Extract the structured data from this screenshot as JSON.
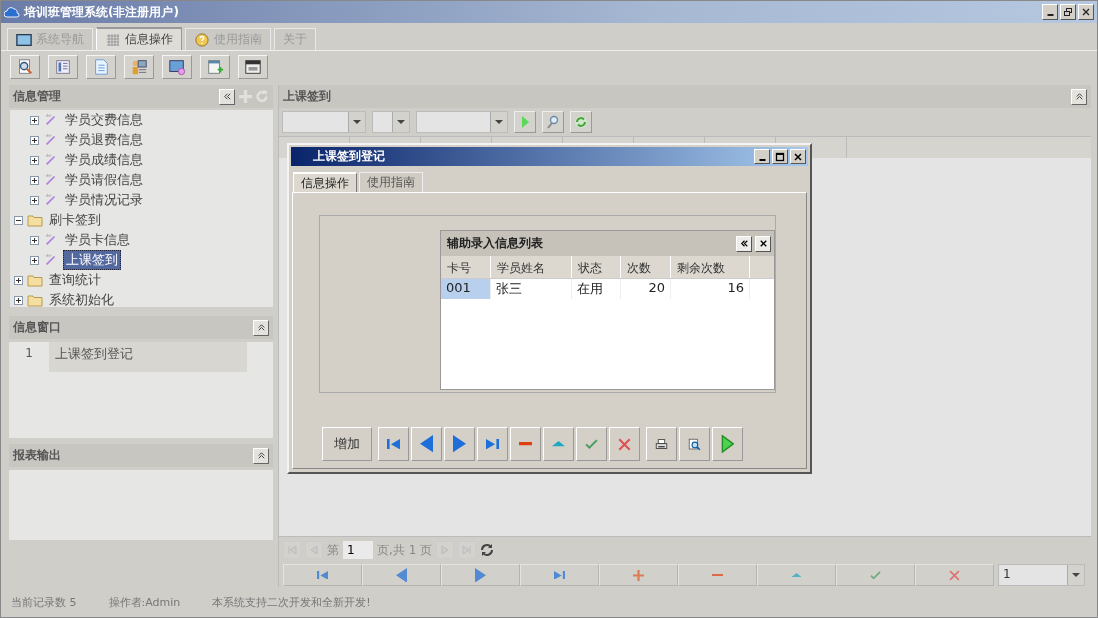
{
  "window": {
    "title": "培训班管理系统(非注册用户)"
  },
  "main_tabs": [
    {
      "label": "系统导航",
      "selected": false
    },
    {
      "label": "信息操作",
      "selected": true
    },
    {
      "label": "使用指南",
      "selected": false
    },
    {
      "label": "关于",
      "selected": false
    }
  ],
  "info_management": {
    "title": "信息管理",
    "tree": [
      {
        "children": [
          {
            "label": "学员交费信息",
            "kind": "module",
            "expanded": false,
            "selected": false
          },
          {
            "label": "学员退费信息",
            "kind": "module",
            "expanded": false,
            "selected": false
          },
          {
            "label": "学员成绩信息",
            "kind": "module",
            "expanded": false,
            "selected": false
          },
          {
            "label": "学员请假信息",
            "kind": "module",
            "expanded": false,
            "selected": false
          },
          {
            "label": "学员情况记录",
            "kind": "module",
            "expanded": false,
            "selected": false
          }
        ]
      },
      {
        "label": "刷卡签到",
        "kind": "folder",
        "expanded": true,
        "selected": false,
        "children": [
          {
            "label": "学员卡信息",
            "kind": "module",
            "expanded": false,
            "selected": false
          },
          {
            "label": "上课签到",
            "kind": "module",
            "expanded": false,
            "selected": true
          }
        ]
      },
      {
        "label": "查询统计",
        "kind": "folder",
        "expanded": false,
        "selected": false
      },
      {
        "label": "系统初始化",
        "kind": "folder",
        "expanded": false,
        "selected": false
      }
    ]
  },
  "info_window": {
    "title": "信息窗口",
    "rows": [
      {
        "index": "1",
        "label": "上课签到登记"
      }
    ]
  },
  "report_output": {
    "title": "报表输出"
  },
  "content": {
    "title": "上课签到",
    "pager": {
      "before": "第",
      "page": "1",
      "after": "页,共 1 页"
    },
    "nav_buttons": [
      {
        "kind": "first"
      },
      {
        "kind": "prev"
      },
      {
        "kind": "next"
      },
      {
        "kind": "last"
      },
      {
        "kind": "add"
      },
      {
        "kind": "remove"
      },
      {
        "kind": "up"
      },
      {
        "kind": "confirm"
      },
      {
        "kind": "cancel"
      }
    ],
    "page_size": "1"
  },
  "dialog": {
    "title": "上课签到登记",
    "tabs": [
      {
        "label": "信息操作",
        "selected": true
      },
      {
        "label": "使用指南",
        "selected": false
      }
    ],
    "list": {
      "title": "辅助录入信息列表",
      "columns": [
        "卡号",
        "学员姓名",
        "状态",
        "次数",
        "剩余次数"
      ],
      "rows": [
        {
          "cells": [
            "001",
            "张三",
            "在用",
            "20",
            "16"
          ],
          "selected": true
        }
      ]
    },
    "add_button": "增加",
    "buttons": [
      {
        "kind": "first"
      },
      {
        "kind": "prev"
      },
      {
        "kind": "next"
      },
      {
        "kind": "last"
      },
      {
        "kind": "remove"
      },
      {
        "kind": "up"
      },
      {
        "kind": "confirm"
      },
      {
        "kind": "cancel"
      },
      {
        "kind": "print"
      },
      {
        "kind": "preview"
      },
      {
        "kind": "run"
      }
    ]
  },
  "status_bar": [
    "当前记录数 5",
    "操作者:Admin",
    "本系统支持二次开发和全新开发!"
  ]
}
